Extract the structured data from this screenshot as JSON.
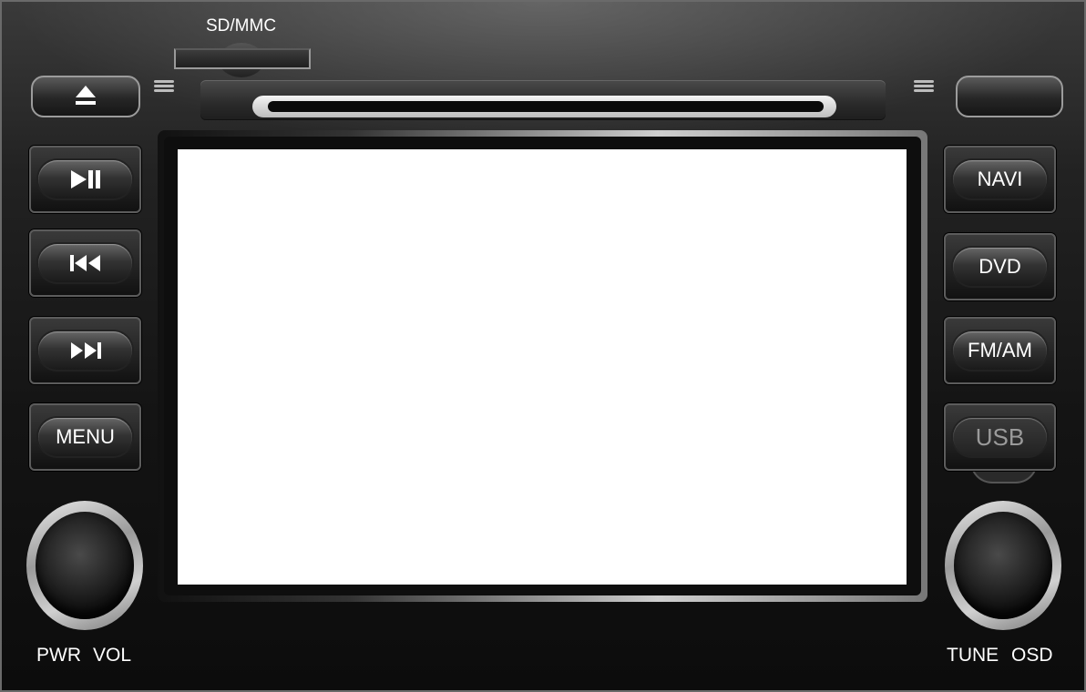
{
  "sd_slot": {
    "label": "SD/MMC"
  },
  "left_buttons": [
    {
      "name": "eject-button",
      "icon": "eject-icon"
    },
    {
      "name": "play-pause-button",
      "icon": "play-pause-icon"
    },
    {
      "name": "previous-track-button",
      "icon": "skip-back-icon"
    },
    {
      "name": "next-track-button",
      "icon": "skip-forward-icon"
    },
    {
      "name": "menu-button",
      "label": "MENU"
    }
  ],
  "right_buttons": {
    "navi": "NAVI",
    "dvd": "DVD",
    "fm_am": "FM/AM",
    "usb": "USB"
  },
  "knobs": {
    "left": {
      "labels": [
        "PWR",
        "VOL"
      ]
    },
    "right": {
      "labels": [
        "TUNE",
        "OSD"
      ]
    }
  },
  "colors": {
    "panel": "#1a1a1a",
    "button_text": "#ffffff",
    "usb_text": "#9a9a9a",
    "screen": "#ffffff"
  }
}
